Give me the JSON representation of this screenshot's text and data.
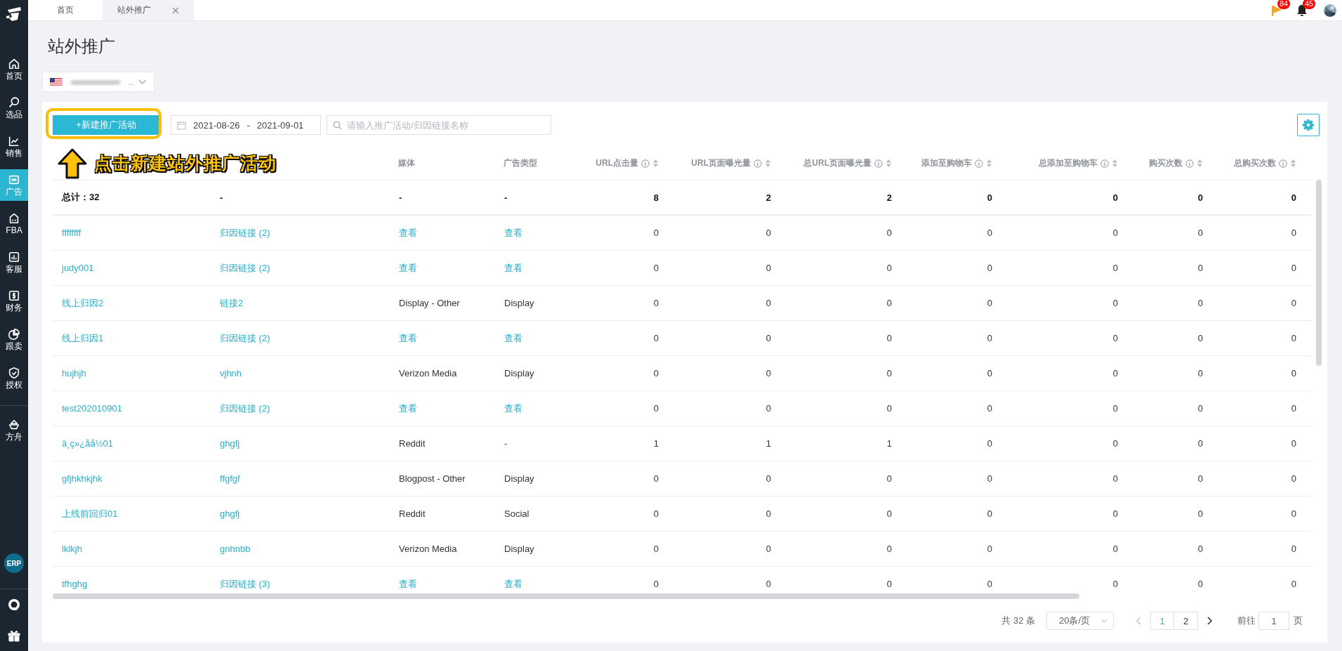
{
  "sidebar": {
    "items": [
      {
        "label": "首页",
        "kind": "home",
        "selected": false
      },
      {
        "label": "选品",
        "kind": "search",
        "selected": false
      },
      {
        "label": "销售",
        "kind": "chart",
        "selected": false
      },
      {
        "label": "广告",
        "kind": "ad",
        "selected": true
      },
      {
        "label": "FBA",
        "kind": "fba",
        "selected": false
      },
      {
        "label": "客服",
        "kind": "bars",
        "selected": false
      },
      {
        "label": "财务",
        "kind": "dollar",
        "selected": false
      },
      {
        "label": "跟卖",
        "kind": "pie",
        "selected": false
      },
      {
        "label": "授权",
        "kind": "shield",
        "selected": false
      },
      {
        "label": "方舟",
        "kind": "ark",
        "selected": false
      }
    ],
    "erp_badge": "ERP"
  },
  "tabs": [
    {
      "label": "首页",
      "selected": false,
      "kind": "fixed"
    },
    {
      "label": "站外推广",
      "selected": true,
      "kind": "closable"
    }
  ],
  "header_icons": [
    {
      "kind": "flag",
      "badge": "84"
    },
    {
      "kind": "bell",
      "badge": "45"
    }
  ],
  "page_title": "站外推广",
  "account_select": {
    "suffix": ".."
  },
  "toolbar": {
    "new_button": "+新建推广活动",
    "date_start": "2021-08-26",
    "date_separator": "-",
    "date_end": "2021-09-01",
    "search_placeholder": "请输入推广活动/归因链接名称"
  },
  "annotation": {
    "text": "点击新建站外推广活动"
  },
  "table": {
    "columns": [
      {
        "kind": "text"
      },
      {
        "kind": "text"
      },
      {
        "label": "媒体",
        "kind": "text"
      },
      {
        "label": "广告类型",
        "kind": "text"
      },
      {
        "label": "URL点击量",
        "kind": "metric"
      },
      {
        "label": "URL页面曝光量",
        "kind": "metric"
      },
      {
        "label": "总URL页面曝光量",
        "kind": "metric"
      },
      {
        "label": "添加至购物车",
        "kind": "metric"
      },
      {
        "label": "总添加至购物车",
        "kind": "metric"
      },
      {
        "label": "购买次数",
        "kind": "metric"
      },
      {
        "label": "总购买次数",
        "kind": "metric"
      }
    ],
    "total": {
      "label": "总计：32",
      "cells": [
        "-",
        "-",
        "-"
      ],
      "metrics": [
        "8",
        "2",
        "2",
        "0",
        "0",
        "0",
        "0"
      ]
    },
    "rows": [
      {
        "name": "ffffffff",
        "link": "归因链接 (2)",
        "media": {
          "text": "查看",
          "kind": "link"
        },
        "ad_type": {
          "text": "查看",
          "kind": "link"
        },
        "metrics": [
          "0",
          "0",
          "0",
          "0",
          "0",
          "0",
          "0"
        ]
      },
      {
        "name": "judy001",
        "link": "归因链接 (2)",
        "media": {
          "text": "查看",
          "kind": "link"
        },
        "ad_type": {
          "text": "查看",
          "kind": "link"
        },
        "metrics": [
          "0",
          "0",
          "0",
          "0",
          "0",
          "0",
          "0"
        ]
      },
      {
        "name": "线上归因2",
        "link": "链接2",
        "media": {
          "text": "Display - Other",
          "kind": "text"
        },
        "ad_type": {
          "text": "Display",
          "kind": "text"
        },
        "metrics": [
          "0",
          "0",
          "0",
          "0",
          "0",
          "0",
          "0"
        ]
      },
      {
        "name": "线上归因1",
        "link": "归因链接 (2)",
        "media": {
          "text": "查看",
          "kind": "link"
        },
        "ad_type": {
          "text": "查看",
          "kind": "link"
        },
        "metrics": [
          "0",
          "0",
          "0",
          "0",
          "0",
          "0",
          "0"
        ]
      },
      {
        "name": "hujhjh",
        "link": "vjhnh",
        "media": {
          "text": "Verizon Media",
          "kind": "text"
        },
        "ad_type": {
          "text": "Display",
          "kind": "text"
        },
        "metrics": [
          "0",
          "0",
          "0",
          "0",
          "0",
          "0",
          "0"
        ]
      },
      {
        "name": "test202010901",
        "link": "归因链接 (2)",
        "media": {
          "text": "查看",
          "kind": "link"
        },
        "ad_type": {
          "text": "查看",
          "kind": "link"
        },
        "metrics": [
          "0",
          "0",
          "0",
          "0",
          "0",
          "0",
          "0"
        ]
      },
      {
        "name": "ä¸ç»¿åå½01",
        "link": "ghgfj",
        "media": {
          "text": "Reddit",
          "kind": "text"
        },
        "ad_type": {
          "text": "-",
          "kind": "text"
        },
        "metrics": [
          "1",
          "1",
          "1",
          "0",
          "0",
          "0",
          "0"
        ]
      },
      {
        "name": "gfjhkhkjhk",
        "link": "ffgfgf",
        "media": {
          "text": "Blogpost - Other",
          "kind": "text"
        },
        "ad_type": {
          "text": "Display",
          "kind": "text"
        },
        "metrics": [
          "0",
          "0",
          "0",
          "0",
          "0",
          "0",
          "0"
        ]
      },
      {
        "name": "上线前回归01",
        "link": "ghgfj",
        "media": {
          "text": "Reddit",
          "kind": "text"
        },
        "ad_type": {
          "text": "Social",
          "kind": "text"
        },
        "metrics": [
          "0",
          "0",
          "0",
          "0",
          "0",
          "0",
          "0"
        ]
      },
      {
        "name": "lklkjh",
        "link": "gnhnbb",
        "media": {
          "text": "Verizon Media",
          "kind": "text"
        },
        "ad_type": {
          "text": "Display",
          "kind": "text"
        },
        "metrics": [
          "0",
          "0",
          "0",
          "0",
          "0",
          "0",
          "0"
        ]
      },
      {
        "name": "tfhghg",
        "link": "归因链接 (3)",
        "media": {
          "text": "查看",
          "kind": "link"
        },
        "ad_type": {
          "text": "查看",
          "kind": "link"
        },
        "metrics": [
          "0",
          "0",
          "0",
          "0",
          "0",
          "0",
          "0"
        ]
      }
    ]
  },
  "pagination": {
    "total": "共 32 条",
    "page_size": "20条/页",
    "pages": [
      {
        "label": "1",
        "selected": true
      },
      {
        "label": "2",
        "selected": false
      }
    ],
    "goto_label": "前往",
    "goto_value": "1",
    "page_unit": "页"
  }
}
